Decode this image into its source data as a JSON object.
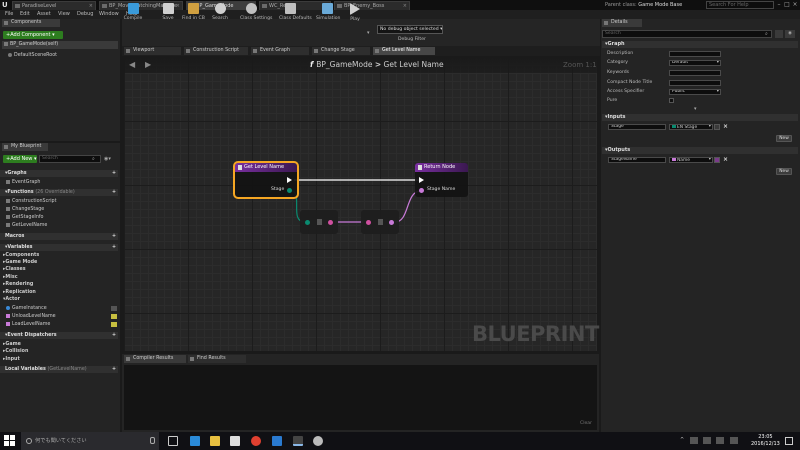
{
  "window": {
    "tabs": [
      "ParadiseLevel",
      "BP_MovieWatchingMachine",
      "BP_GameMode",
      "WC_Result",
      "BP_Enemy_Boss"
    ],
    "active_tab": 2,
    "parent_class_label": "Parent class:",
    "parent_class_value": "Game Mode Base",
    "help_search_placeholder": "Search For Help"
  },
  "menu": [
    "File",
    "Edit",
    "Asset",
    "View",
    "Debug",
    "Window",
    "Help"
  ],
  "toolbar": {
    "items": [
      {
        "label": "Compile",
        "icon": "compile-icon",
        "color": "#3a9ad9"
      },
      {
        "label": "Save",
        "icon": "save-icon",
        "color": "#d0d0d0"
      },
      {
        "label": "Find in CB",
        "icon": "find-in-cb-icon",
        "color": "#d0a040"
      },
      {
        "label": "Search",
        "icon": "search-icon",
        "color": "#d0d0d0"
      },
      {
        "label": "Class Settings",
        "icon": "class-settings-icon",
        "color": "#c0c0c0"
      },
      {
        "label": "Class Defaults",
        "icon": "class-defaults-icon",
        "color": "#c0c0c0"
      },
      {
        "label": "Simulation",
        "icon": "simulation-icon",
        "color": "#6aaad8"
      },
      {
        "label": "Play",
        "icon": "play-icon",
        "color": "#d0d0d0"
      }
    ],
    "debug_select": "No debug object selected",
    "debug_filter": "Debug Filter"
  },
  "components": {
    "tab": "Components",
    "add_button": "+Add Component",
    "items": [
      "BP_GameMode(self)",
      "DefaultSceneRoot"
    ]
  },
  "my_blueprint": {
    "tab": "My Blueprint",
    "add_new": "+Add New",
    "search_placeholder": "Search",
    "graphs_header": "Graphs",
    "graphs": [
      "EventGraph"
    ],
    "functions_header": "Functions",
    "functions_note": "(26 Overridable)",
    "functions": [
      "ConstructionScript",
      "ChangeStage",
      "GetStageInfo",
      "GetLevelName"
    ],
    "macros_header": "Macros",
    "variables_header": "Variables",
    "variable_categories": [
      "Components",
      "Game Mode",
      "Classes",
      "Misc",
      "Rendering",
      "Replication",
      "Actor"
    ],
    "variables": [
      "GameInstance",
      "UnloadLevelName",
      "LoadLevelName"
    ],
    "dispatchers_header": "Event Dispatchers",
    "dispatcher_categories": [
      "Game",
      "Collision",
      "Input"
    ],
    "local_vars_header": "Local Variables",
    "local_vars_note": "(GetLevelName)"
  },
  "editor_tabs": [
    "Viewport",
    "Construction Script",
    "Event Graph",
    "Change Stage",
    "Get Level Name"
  ],
  "graph": {
    "breadcrumb_root": "BP_GameMode",
    "breadcrumb_sep": ">",
    "breadcrumb_current": "Get Level Name",
    "zoom": "Zoom 1:1",
    "watermark": "BLUEPRINT",
    "entry_node": {
      "title": "Get Level Name",
      "pin": "Stage"
    },
    "return_node": {
      "title": "Return Node",
      "pin": "Stage Name"
    }
  },
  "details": {
    "tab": "Details",
    "search_placeholder": "Search",
    "graph_header": "Graph",
    "rows": [
      {
        "label": "Description",
        "value": ""
      },
      {
        "label": "Category",
        "value": "Default"
      },
      {
        "label": "Keywords",
        "value": ""
      },
      {
        "label": "Compact Node Title",
        "value": ""
      },
      {
        "label": "Access Specifier",
        "value": "Public"
      },
      {
        "label": "Pure",
        "value": ""
      }
    ],
    "inputs_header": "Inputs",
    "input_name": "Stage",
    "input_type": "EN Stage",
    "outputs_header": "Outputs",
    "output_name": "StageName",
    "output_type": "Name",
    "new_button": "New"
  },
  "bottom": {
    "tabs": [
      "Compiler Results",
      "Find Results"
    ],
    "clear": "Clear"
  },
  "taskbar": {
    "search_placeholder": "何でも聞いてください",
    "time": "23:05",
    "date": "2016/12/13"
  },
  "colors": {
    "accent_green": "#2d7d1f",
    "function_purple": "#7a2fa0",
    "enum_pin": "#0a8a70",
    "name_pin": "#c87ad8",
    "selection": "#f5a623"
  }
}
